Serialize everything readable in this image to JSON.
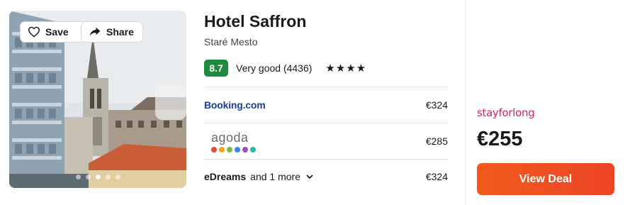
{
  "photo": {
    "save_label": "Save",
    "share_label": "Share",
    "slide_count": 5,
    "active_slide": 3
  },
  "hotel": {
    "name": "Hotel Saffron",
    "location": "Staré Mesto",
    "score": "8.7",
    "rating_text": "Very good (4436)",
    "stars": "★★★★"
  },
  "offers": [
    {
      "provider": "Booking.com",
      "price": "€324"
    },
    {
      "provider": "agoda",
      "price": "€285",
      "logo_dot_colors": [
        "#e8493f",
        "#f4a51c",
        "#79bc3d",
        "#3e84f0",
        "#9a4fb4",
        "#2bb6a8"
      ]
    },
    {
      "provider": "eDreams",
      "more": "and 1 more",
      "price": "€324"
    }
  ],
  "deal": {
    "provider": "stayforlong",
    "price": "€255",
    "button_label": "View Deal"
  },
  "colors": {
    "accent": "#f0531f",
    "score_bg": "#1e8a3c",
    "booking_blue": "#1b3f94",
    "stayforlong_pink": "#d6206d"
  },
  "icons": {
    "save": "heart-icon",
    "share": "share-arrow-icon",
    "dropdown": "chevron-down-icon"
  }
}
